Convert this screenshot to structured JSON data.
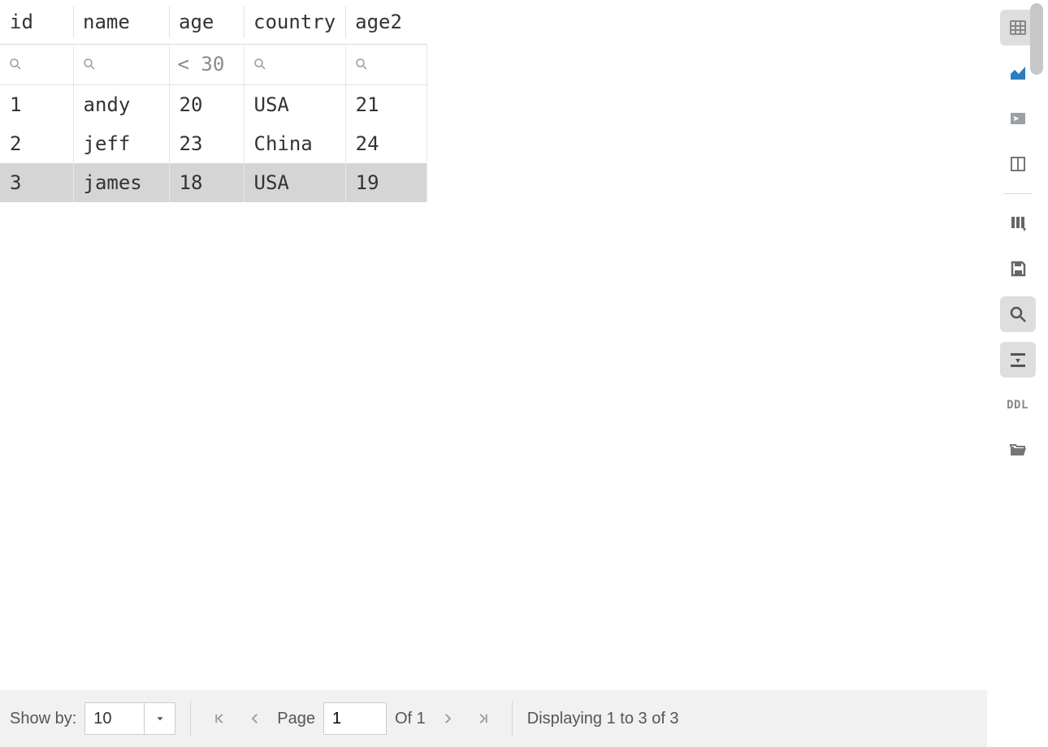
{
  "table": {
    "columns": [
      "id",
      "name",
      "age",
      "country",
      "age2"
    ],
    "filters": {
      "id": "",
      "name": "",
      "age": "< 30",
      "country": "",
      "age2": ""
    },
    "rows": [
      {
        "id": "1",
        "name": "andy",
        "age": "20",
        "country": "USA",
        "age2": "21",
        "selected": false
      },
      {
        "id": "2",
        "name": "jeff",
        "age": "23",
        "country": "China",
        "age2": "24",
        "selected": false
      },
      {
        "id": "3",
        "name": "james",
        "age": "18",
        "country": "USA",
        "age2": "19",
        "selected": true
      }
    ]
  },
  "pagination": {
    "show_by_label": "Show by:",
    "show_by_value": "10",
    "page_label": "Page",
    "page_value": "1",
    "of_text": "Of 1",
    "status": "Displaying 1 to 3 of 3"
  },
  "sidebar": {
    "items": [
      {
        "name": "table-view-icon",
        "active": true
      },
      {
        "name": "chart-view-icon",
        "active": false
      },
      {
        "name": "console-icon",
        "active": false
      },
      {
        "name": "columns-icon",
        "active": false
      }
    ],
    "items2": [
      {
        "name": "column-settings-icon",
        "active": false
      },
      {
        "name": "save-icon",
        "active": false
      },
      {
        "name": "search-icon",
        "active": true
      },
      {
        "name": "transpose-icon",
        "active": true
      },
      {
        "name": "ddl-icon",
        "active": false,
        "label": "DDL"
      },
      {
        "name": "folder-open-icon",
        "active": false
      }
    ]
  }
}
